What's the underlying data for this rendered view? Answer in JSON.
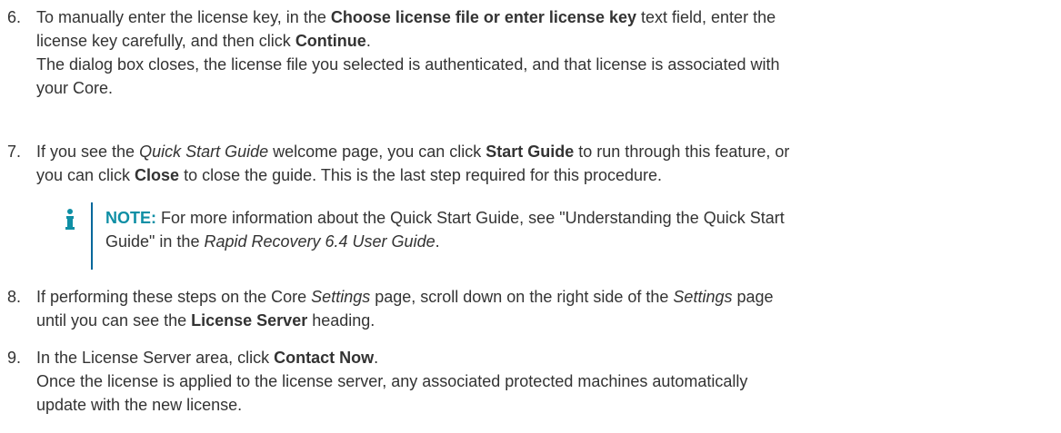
{
  "steps": [
    {
      "number": "6.",
      "lines": [
        {
          "a": "To manually enter the license key, in the ",
          "b": "Choose license file or enter license key",
          "c": " text field, enter the"
        },
        {
          "a": "license key carefully, and then click ",
          "b": "Continue",
          "c": "."
        },
        {
          "a": "The dialog box closes, the license file you selected is authenticated, and that license is associated with"
        },
        {
          "a": "your Core."
        }
      ]
    },
    {
      "number": "7.",
      "lines": [
        {
          "a": "If you see the ",
          "i": "Quick Start Guide",
          "b0": " welcome page, you can click ",
          "b": "Start Guide",
          "c": " to run through this feature, or"
        },
        {
          "a": "you can click ",
          "b": "Close",
          "c": " to close the guide. This is the last step required for this procedure."
        }
      ]
    },
    {
      "number": "8.",
      "lines": [
        {
          "a": "If performing these steps on the Core ",
          "i": "Settings",
          "b0": " page, scroll down on the right side of the ",
          "i2": "Settings",
          "c": " page"
        },
        {
          "a": "until you can see the ",
          "b": "License Server",
          "c": " heading."
        }
      ]
    },
    {
      "number": "9.",
      "lines": [
        {
          "a": "In the License Server area, click ",
          "b": "Contact Now",
          "c": "."
        },
        {
          "a": "Once the license is applied to the license server, any associated protected machines automatically"
        },
        {
          "a": "update with the new license."
        }
      ]
    }
  ],
  "note": {
    "label": "NOTE:",
    "line1": " For more information about the Quick Start Guide, see \"Understanding the Quick Start",
    "line2a": "Guide\" in the ",
    "line2i": "Rapid Recovery 6.4 User Guide",
    "line2c": ".",
    "icon": "info-icon",
    "icon_color": "#0f8fa5",
    "bar_color": "#00679b"
  }
}
